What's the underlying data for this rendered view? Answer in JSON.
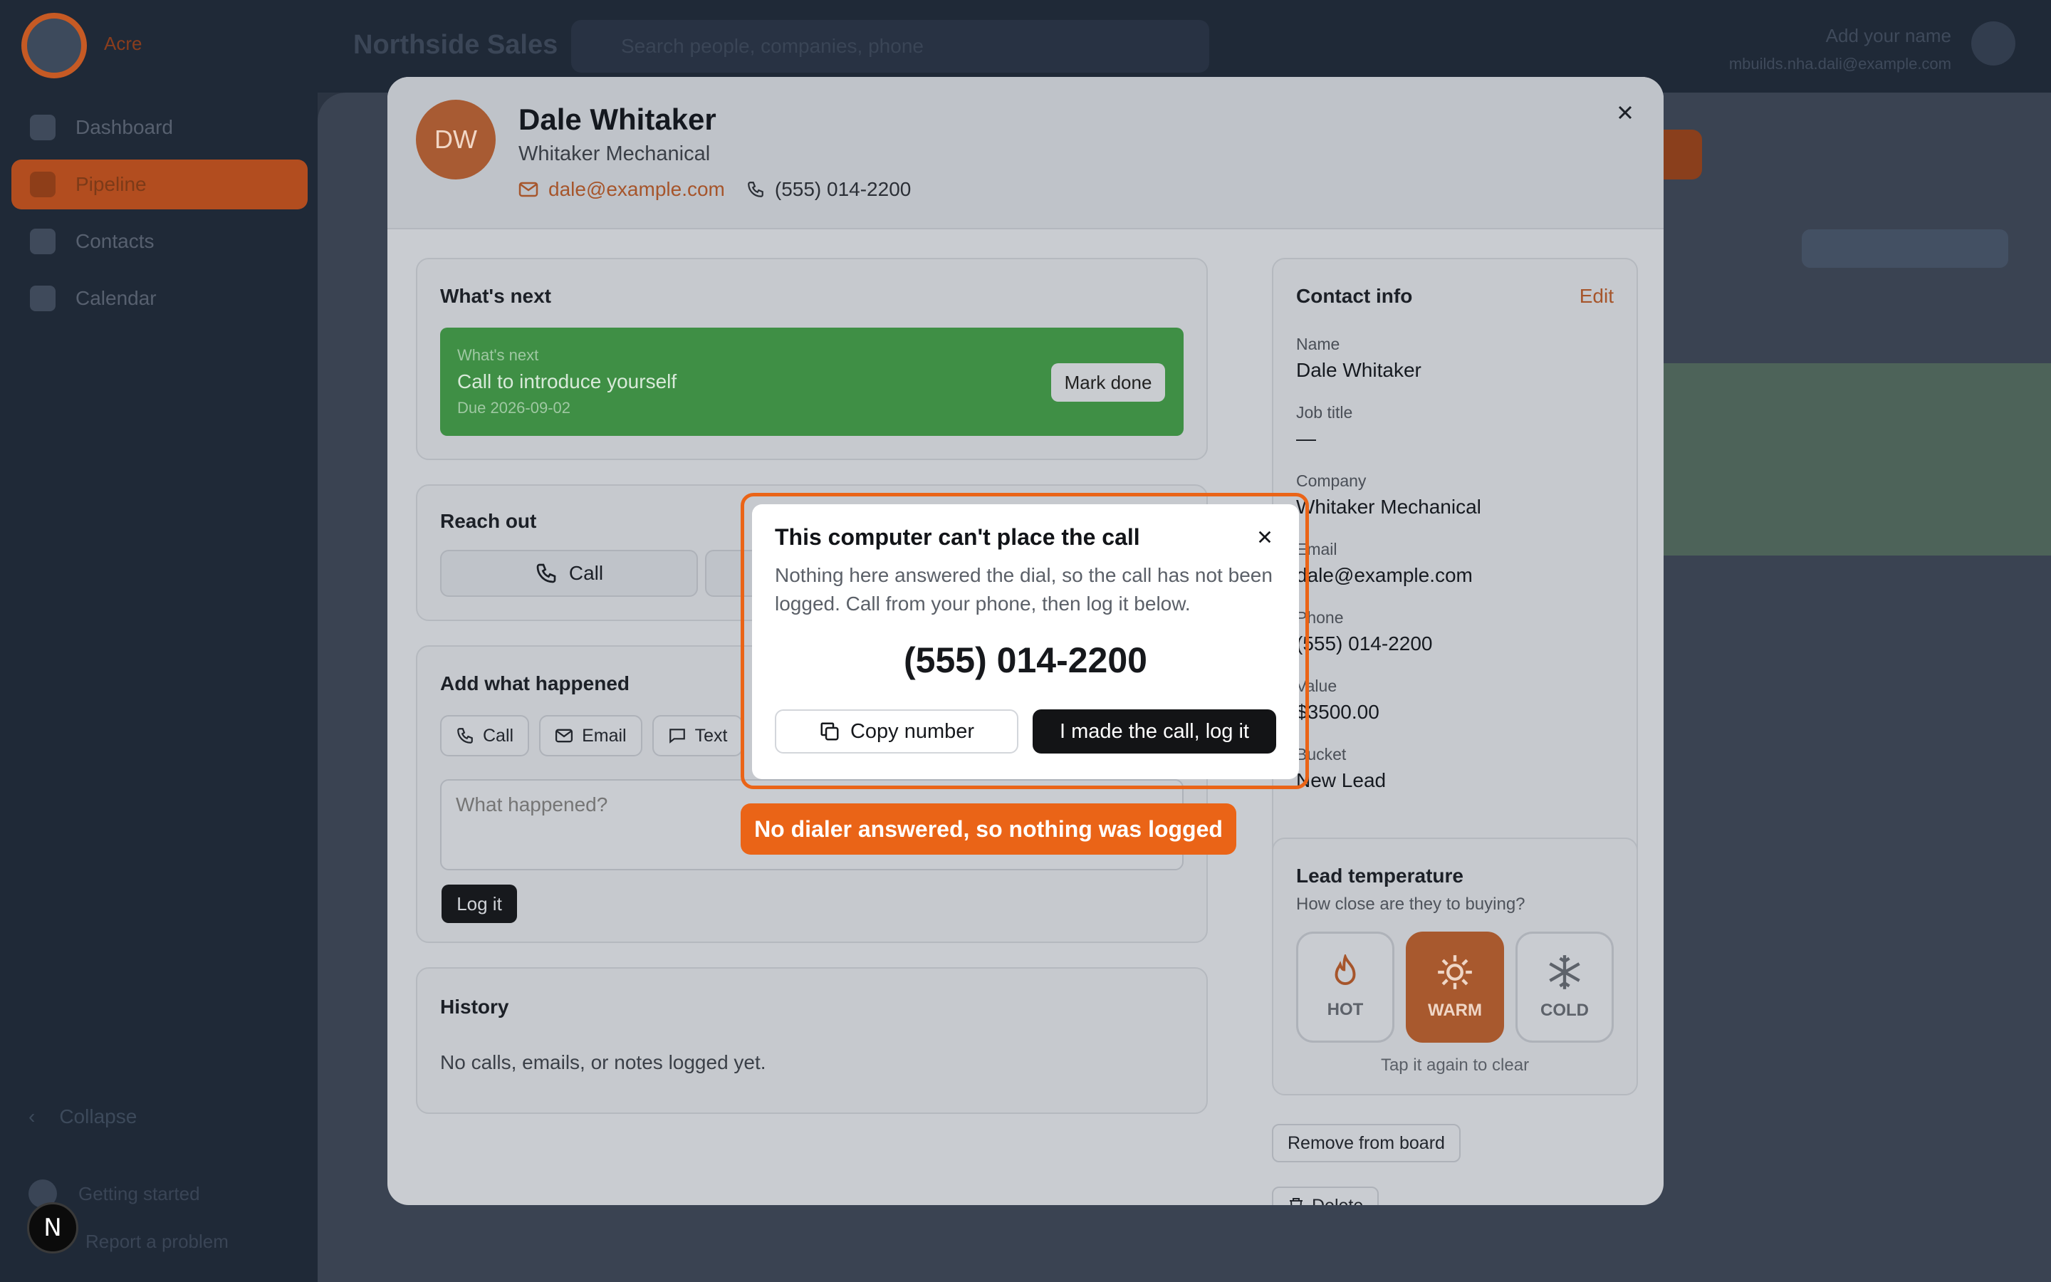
{
  "background": {
    "brand": "Acre",
    "workspace": "Northside Sales",
    "search_placeholder": "Search people, companies, phone",
    "user_name": "Add your name",
    "user_email": "mbuilds.nha.dali@example.com",
    "nav": [
      {
        "label": "Dashboard",
        "icon": "grid-icon"
      },
      {
        "label": "Pipeline",
        "icon": "board-icon"
      },
      {
        "label": "Contacts",
        "icon": "people-icon"
      },
      {
        "label": "Calendar",
        "icon": "calendar-icon"
      }
    ],
    "collapse_label": "Collapse",
    "footer": [
      "Getting started",
      "Report a problem"
    ],
    "next_badge": "N"
  },
  "contact": {
    "initials": "DW",
    "name": "Dale Whitaker",
    "company": "Whitaker Mechanical",
    "email": "dale@example.com",
    "phone": "(555) 014-2200",
    "close_label": "×"
  },
  "whats_next": {
    "title": "What's next",
    "banner_kicker": "What's next",
    "banner_task": "Call to introduce yourself",
    "banner_due": "Due 2026-09-02",
    "mark_done": "Mark done"
  },
  "reach_out": {
    "title": "Reach out",
    "call_label": "Call"
  },
  "add_what_happened": {
    "title": "Add what happened",
    "chips": [
      "Call",
      "Email",
      "Text"
    ],
    "placeholder": "What happened?",
    "log_label": "Log it"
  },
  "history": {
    "title": "History",
    "empty": "No calls, emails, or notes logged yet."
  },
  "contact_info": {
    "title": "Contact info",
    "edit": "Edit",
    "fields": [
      {
        "label": "Name",
        "value": "Dale Whitaker"
      },
      {
        "label": "Job title",
        "value": "—"
      },
      {
        "label": "Company",
        "value": "Whitaker Mechanical"
      },
      {
        "label": "Email",
        "value": "dale@example.com"
      },
      {
        "label": "Phone",
        "value": "(555) 014-2200"
      },
      {
        "label": "Value",
        "value": "$3500.00"
      },
      {
        "label": "Bucket",
        "value": "New Lead"
      }
    ]
  },
  "lead_temperature": {
    "title": "Lead temperature",
    "subtitle": "How close are they to buying?",
    "options": [
      {
        "label": "HOT",
        "icon": "flame-icon"
      },
      {
        "label": "WARM",
        "icon": "sun-icon"
      },
      {
        "label": "COLD",
        "icon": "snowflake-icon"
      }
    ],
    "selected": "WARM",
    "hint": "Tap it again to clear"
  },
  "actions": {
    "remove": "Remove from board",
    "delete": "Delete"
  },
  "call_dialog": {
    "title": "This computer can't place the call",
    "message": "Nothing here answered the dial, so the call has not been logged. Call from your phone, then log it below.",
    "number": "(555) 014-2200",
    "copy_label": "Copy number",
    "log_label": "I made the call, log it"
  },
  "toast": {
    "text": "No dialer answered, so nothing was logged"
  },
  "colors": {
    "accent": "#ea6417",
    "banner_green": "#3f8f45",
    "warm": "#a8592e"
  }
}
